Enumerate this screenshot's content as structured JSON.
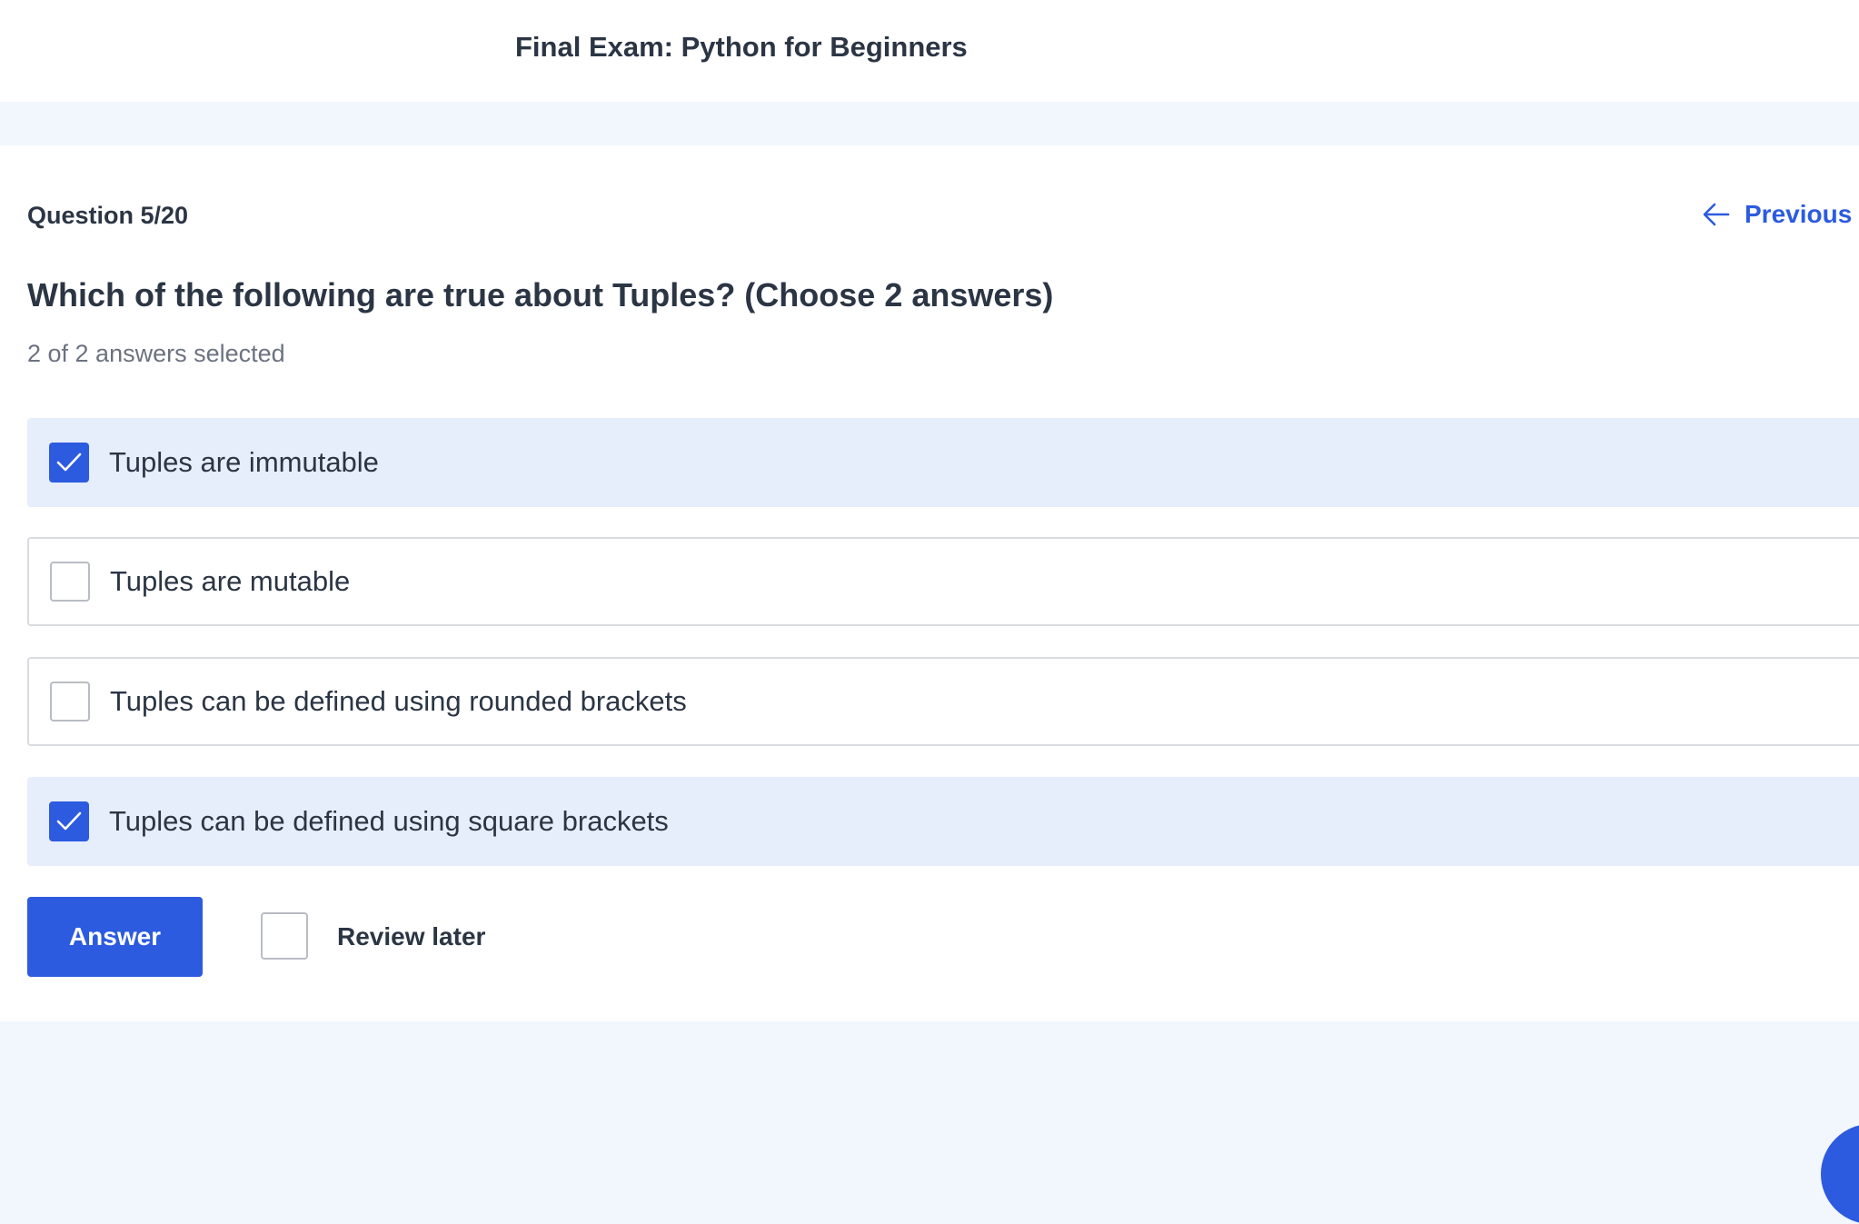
{
  "header": {
    "title": "Final Exam: Python for Beginners"
  },
  "question": {
    "counter": "Question 5/20",
    "previous_label": "Previous",
    "text": "Which of the following are true about Tuples? (Choose 2 answers)",
    "selection_status": "2 of 2 answers selected",
    "options": [
      {
        "label": "Tuples are immutable",
        "checked": true
      },
      {
        "label": "Tuples are mutable",
        "checked": false
      },
      {
        "label": "Tuples can be defined using rounded brackets",
        "checked": false
      },
      {
        "label": "Tuples can be defined using square brackets",
        "checked": true
      }
    ]
  },
  "actions": {
    "answer_label": "Answer",
    "review_later_label": "Review later",
    "review_later_checked": false
  },
  "colors": {
    "accent": "#2c5be0",
    "selected_bg": "#e6edfb",
    "page_bg": "#f2f6fd",
    "text": "#2b3544",
    "muted_text": "#6b7280"
  },
  "icons": {
    "previous": "arrow-left-icon",
    "check": "checkmark-icon"
  }
}
